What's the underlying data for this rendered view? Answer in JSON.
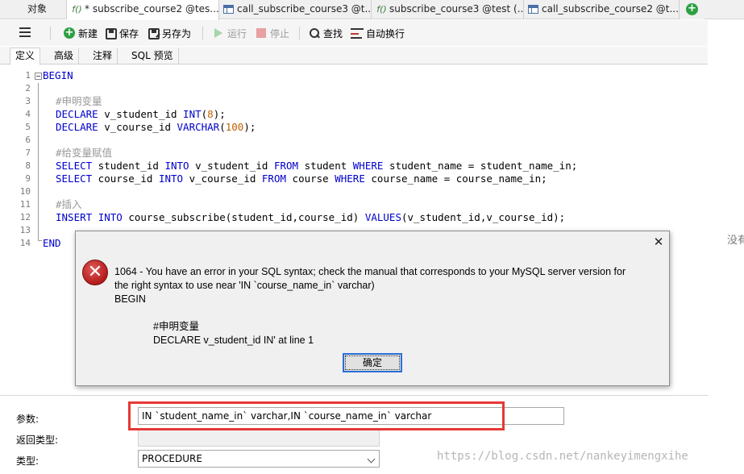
{
  "tabs": [
    {
      "label": "对象",
      "icon": "none",
      "active": false
    },
    {
      "label": "* subscribe_course2 @tes...",
      "icon": "procedure",
      "active": true
    },
    {
      "label": "call_subscribe_course3 @t...",
      "icon": "query",
      "active": false
    },
    {
      "label": "subscribe_course3 @test (...",
      "icon": "procedure",
      "active": false
    },
    {
      "label": "call_subscribe_course2 @t...",
      "icon": "query",
      "active": false
    }
  ],
  "procedure_icon_text": "f()",
  "toolbar": {
    "new_label": "新建",
    "save_label": "保存",
    "save_as_label": "另存为",
    "run_label": "运行",
    "stop_label": "停止",
    "find_label": "查找",
    "wrap_label": "自动换行"
  },
  "subtabs": [
    "定义",
    "高级",
    "注释",
    "SQL 预览"
  ],
  "line_numbers": [
    "1",
    "2",
    "3",
    "4",
    "5",
    "6",
    "7",
    "8",
    "9",
    "10",
    "11",
    "12",
    "13",
    "14"
  ],
  "code": {
    "l1_kw": "BEGIN",
    "l3_cm": "#申明变量",
    "l4_kw1": "DECLARE",
    "l4_id": " v_student_id ",
    "l4_kw2": "INT",
    "l4_p1": "(",
    "l4_num": "8",
    "l4_p2": ");",
    "l5_kw1": "DECLARE",
    "l5_id": " v_course_id ",
    "l5_kw2": "VARCHAR",
    "l5_p1": "(",
    "l5_num": "100",
    "l5_p2": ");",
    "l7_cm": "#给变量赋值",
    "l8_kw1": "SELECT",
    "l8_a": " student_id ",
    "l8_kw2": "INTO",
    "l8_b": " v_student_id ",
    "l8_kw3": "FROM",
    "l8_c": " student ",
    "l8_kw4": "WHERE",
    "l8_d": " student_name = student_name_in;",
    "l9_kw1": "SELECT",
    "l9_a": " course_id ",
    "l9_kw2": "INTO",
    "l9_b": " v_course_id ",
    "l9_kw3": "FROM",
    "l9_c": " course ",
    "l9_kw4": "WHERE",
    "l9_d": " course_name = course_name_in;",
    "l11_cm": "#插入",
    "l12_kw1": "INSERT",
    "l12_sp": " ",
    "l12_kw2": "INTO",
    "l12_a": " course_subscribe(student_id,course_id) ",
    "l12_kw3": "VALUES",
    "l12_b": "(v_student_id,v_course_id);",
    "l14_kw": "END"
  },
  "right_hint": "没有",
  "dialog": {
    "close_glyph": "✕",
    "icon_glyph": "✕",
    "line1": "1064 - You have an error in your SQL syntax; check the manual that corresponds to your MySQL server version for",
    "line2": "the right syntax to use near 'IN `course_name_in` varchar)",
    "line3": "BEGIN",
    "line4": "#申明变量",
    "line5": "DECLARE v_student_id IN' at line 1",
    "ok_label": "确定"
  },
  "form": {
    "params_label": "参数:",
    "params_value": "IN `student_name_in` varchar,IN `course_name_in` varchar",
    "return_label": "返回类型:",
    "return_value": "",
    "type_label": "类型:",
    "type_value": "PROCEDURE"
  },
  "watermark": "https://blog.csdn.net/nankeyimengxihe",
  "colors": {
    "keyword": "#0000cc",
    "comment": "#999999",
    "number": "#c06000",
    "highlight_box": "#e53935"
  }
}
